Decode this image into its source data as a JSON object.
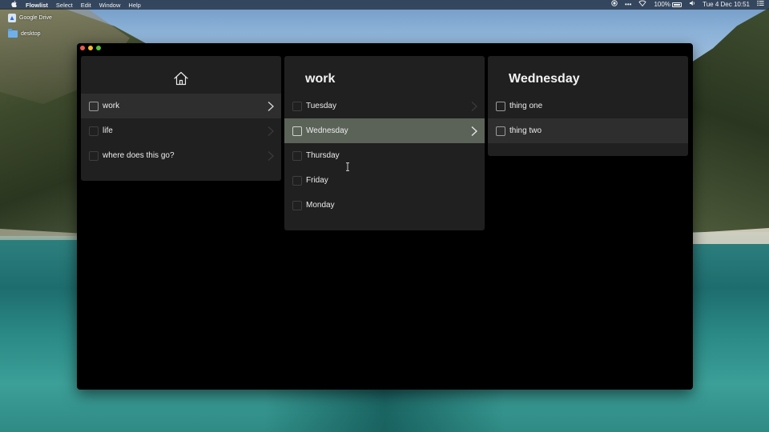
{
  "menubar": {
    "app_name": "Flowlist",
    "menus": [
      "Select",
      "Edit",
      "Window",
      "Help"
    ],
    "battery": "100%",
    "clock": "Tue 4 Dec  10:51"
  },
  "desktop": {
    "icons": [
      {
        "label": "Google Drive",
        "icon": "google-drive-icon"
      },
      {
        "label": "desktop",
        "icon": "folder-icon"
      }
    ]
  },
  "columns": [
    {
      "title": "",
      "header_icon": "home-icon",
      "items": [
        {
          "label": "work",
          "has_children": true,
          "state": "selected"
        },
        {
          "label": "life",
          "has_children": true,
          "state": "normal"
        },
        {
          "label": "where does this go?",
          "has_children": true,
          "state": "normal"
        }
      ]
    },
    {
      "title": "work",
      "items": [
        {
          "label": "Tuesday",
          "has_children": true,
          "state": "normal"
        },
        {
          "label": "Wednesday",
          "has_children": true,
          "state": "highlighted"
        },
        {
          "label": "Thursday",
          "has_children": false,
          "state": "normal"
        },
        {
          "label": "Friday",
          "has_children": false,
          "state": "normal"
        },
        {
          "label": "Monday",
          "has_children": false,
          "state": "normal"
        }
      ]
    },
    {
      "title": "Wednesday",
      "items": [
        {
          "label": "thing one",
          "has_children": false,
          "state": "normal"
        },
        {
          "label": "thing two",
          "has_children": false,
          "state": "selected"
        }
      ]
    }
  ],
  "colors": {
    "window_bg": "#000000",
    "column_bg": "#202020",
    "row_selected": "#2e2e2e",
    "row_highlighted": "#5b6358"
  }
}
